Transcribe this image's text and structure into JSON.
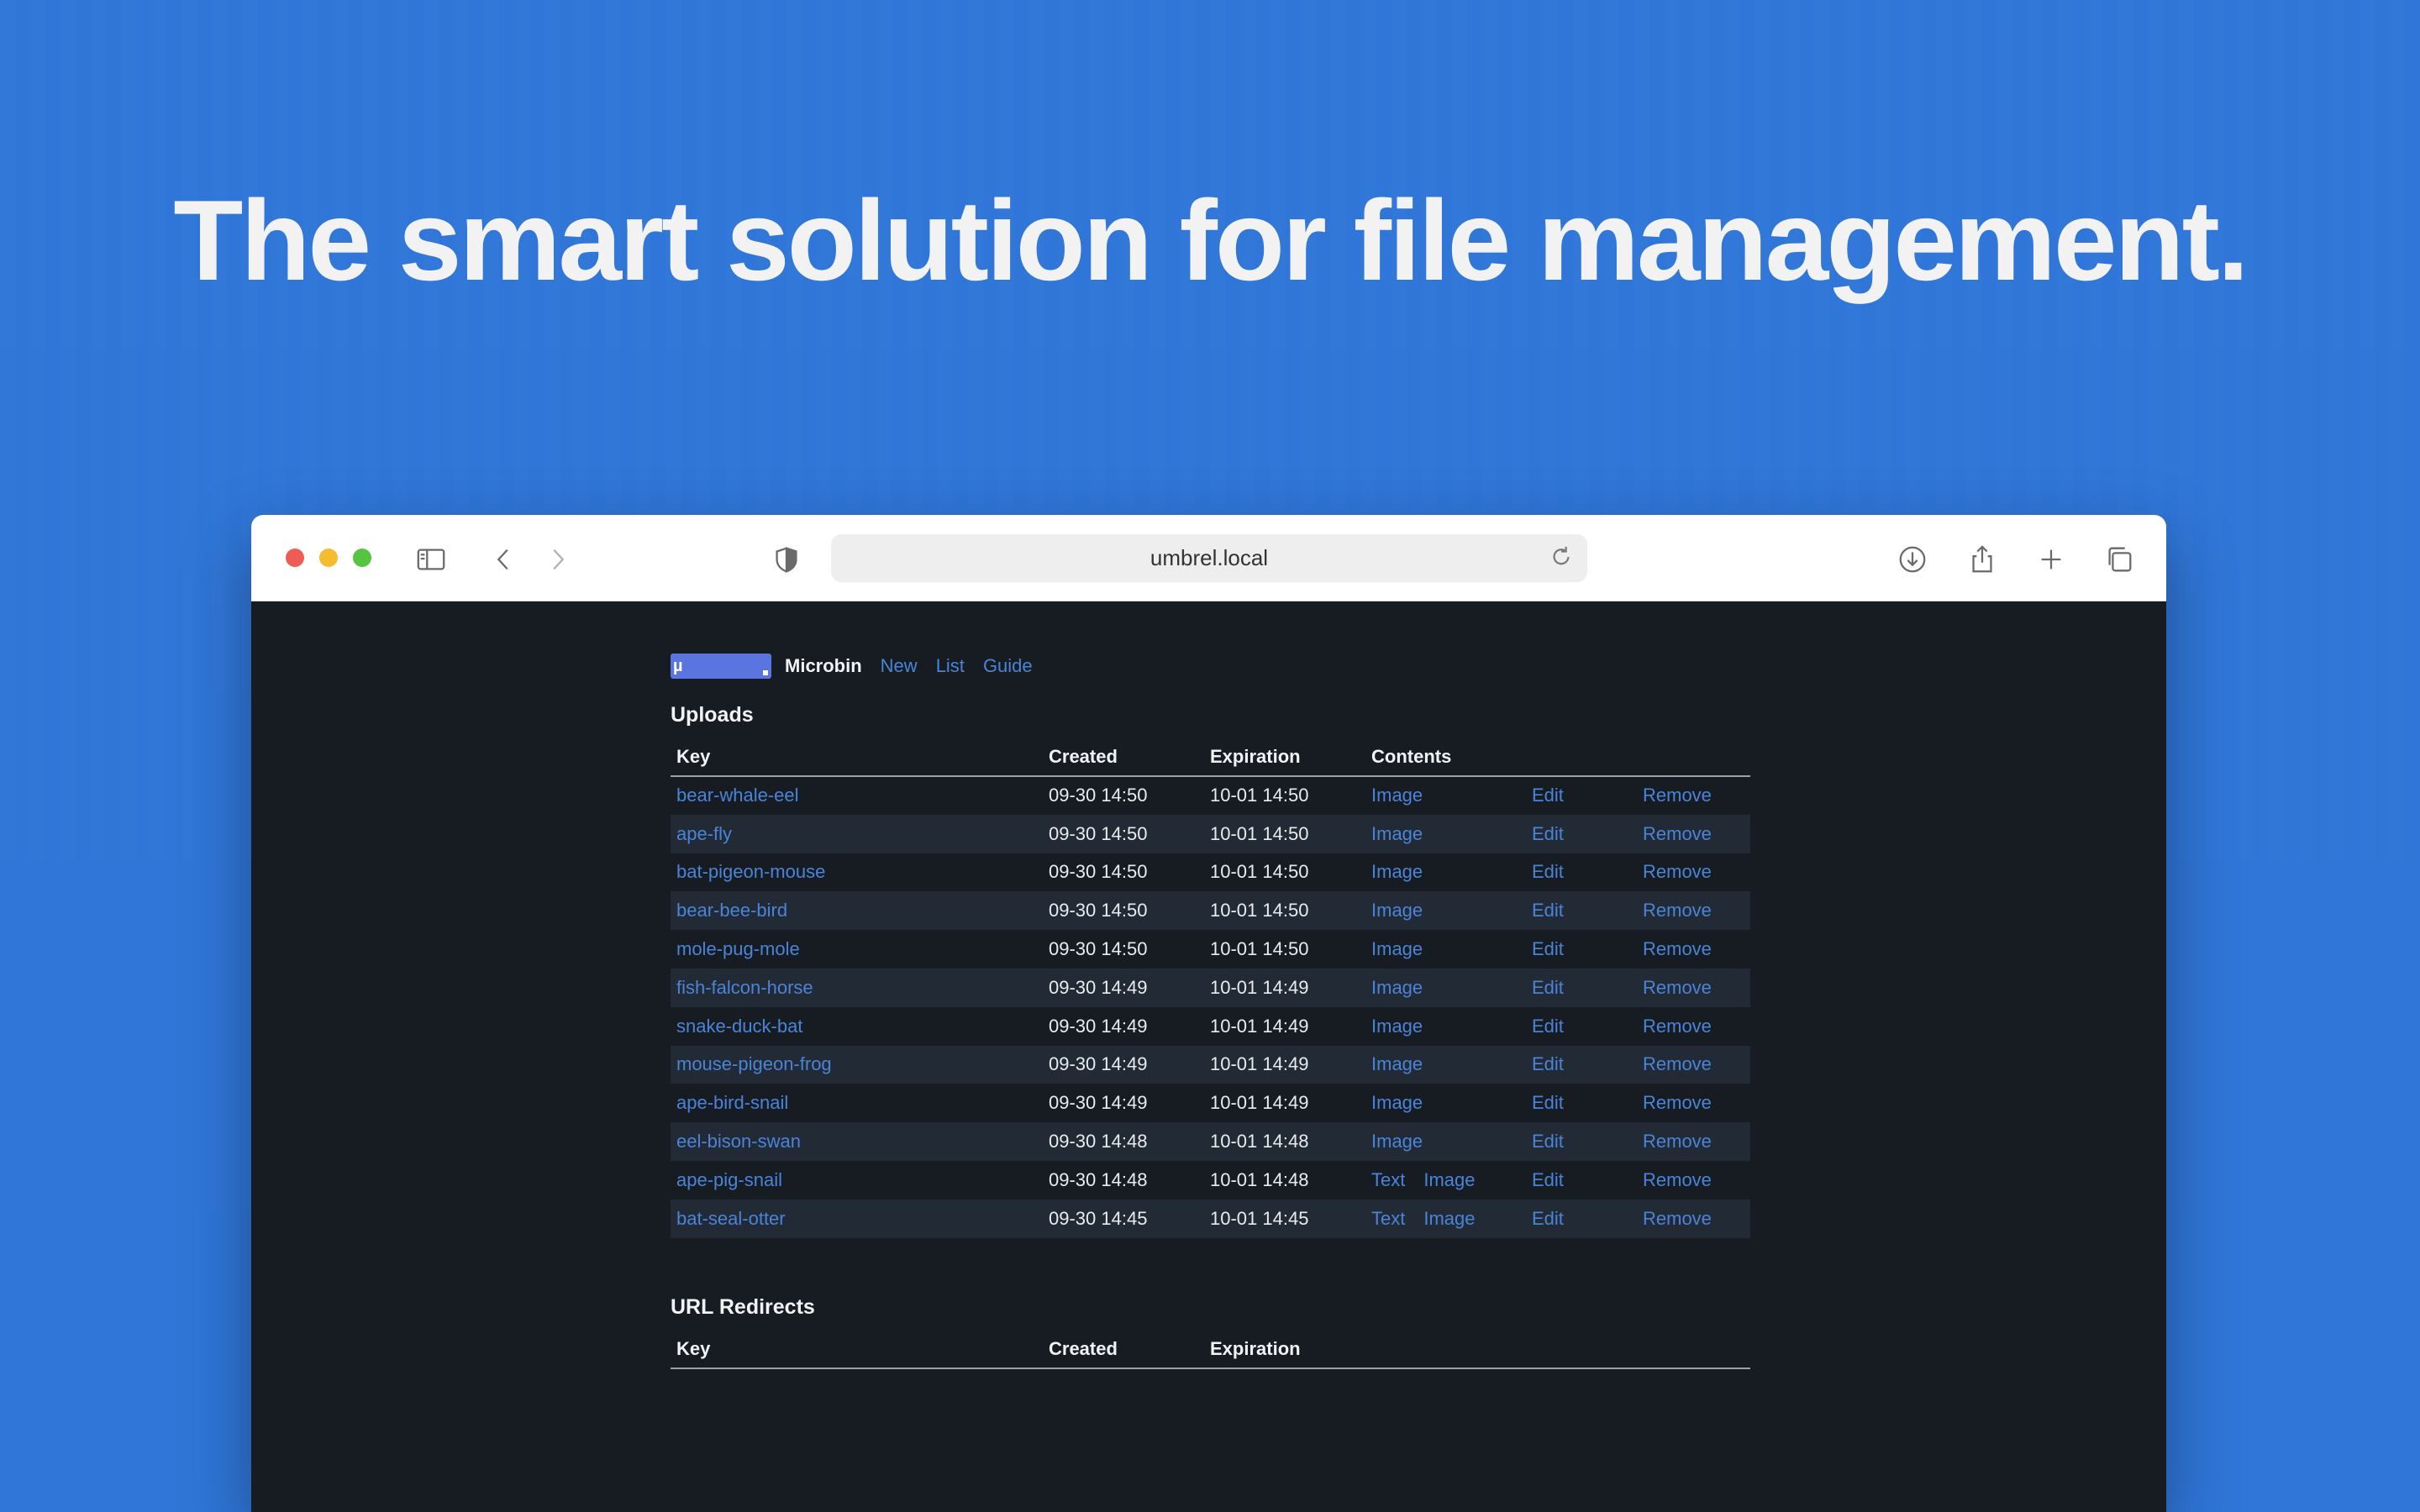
{
  "headline": "The smart solution for file management.",
  "browser": {
    "url": "umbrel.local"
  },
  "app": {
    "brand": "Microbin",
    "logo_text": "µ",
    "nav": [
      "New",
      "List",
      "Guide"
    ]
  },
  "uploads": {
    "title": "Uploads",
    "headers": {
      "key": "Key",
      "created": "Created",
      "expiration": "Expiration",
      "contents": "Contents"
    },
    "rows": [
      {
        "key": "bear-whale-eel",
        "created": "09-30 14:50",
        "expiration": "10-01 14:50",
        "text": "",
        "image": "Image",
        "edit": "Edit",
        "remove": "Remove"
      },
      {
        "key": "ape-fly",
        "created": "09-30 14:50",
        "expiration": "10-01 14:50",
        "text": "",
        "image": "Image",
        "edit": "Edit",
        "remove": "Remove"
      },
      {
        "key": "bat-pigeon-mouse",
        "created": "09-30 14:50",
        "expiration": "10-01 14:50",
        "text": "",
        "image": "Image",
        "edit": "Edit",
        "remove": "Remove"
      },
      {
        "key": "bear-bee-bird",
        "created": "09-30 14:50",
        "expiration": "10-01 14:50",
        "text": "",
        "image": "Image",
        "edit": "Edit",
        "remove": "Remove"
      },
      {
        "key": "mole-pug-mole",
        "created": "09-30 14:50",
        "expiration": "10-01 14:50",
        "text": "",
        "image": "Image",
        "edit": "Edit",
        "remove": "Remove"
      },
      {
        "key": "fish-falcon-horse",
        "created": "09-30 14:49",
        "expiration": "10-01 14:49",
        "text": "",
        "image": "Image",
        "edit": "Edit",
        "remove": "Remove"
      },
      {
        "key": "snake-duck-bat",
        "created": "09-30 14:49",
        "expiration": "10-01 14:49",
        "text": "",
        "image": "Image",
        "edit": "Edit",
        "remove": "Remove"
      },
      {
        "key": "mouse-pigeon-frog",
        "created": "09-30 14:49",
        "expiration": "10-01 14:49",
        "text": "",
        "image": "Image",
        "edit": "Edit",
        "remove": "Remove"
      },
      {
        "key": "ape-bird-snail",
        "created": "09-30 14:49",
        "expiration": "10-01 14:49",
        "text": "",
        "image": "Image",
        "edit": "Edit",
        "remove": "Remove"
      },
      {
        "key": "eel-bison-swan",
        "created": "09-30 14:48",
        "expiration": "10-01 14:48",
        "text": "",
        "image": "Image",
        "edit": "Edit",
        "remove": "Remove"
      },
      {
        "key": "ape-pig-snail",
        "created": "09-30 14:48",
        "expiration": "10-01 14:48",
        "text": "Text",
        "image": "Image",
        "edit": "Edit",
        "remove": "Remove"
      },
      {
        "key": "bat-seal-otter",
        "created": "09-30 14:45",
        "expiration": "10-01 14:45",
        "text": "Text",
        "image": "Image",
        "edit": "Edit",
        "remove": "Remove"
      }
    ]
  },
  "redirects": {
    "title": "URL Redirects",
    "headers": {
      "key": "Key",
      "created": "Created",
      "expiration": "Expiration"
    }
  },
  "colors": {
    "background": "#2f76d8",
    "page": "#171c23",
    "link": "#4a84d8",
    "stripe": "#222a35",
    "logo": "#5a74e0"
  },
  "icons": [
    "sidebar-icon",
    "back-icon",
    "forward-icon",
    "shield-icon",
    "reload-icon",
    "download-icon",
    "share-icon",
    "plus-icon",
    "tabs-icon"
  ]
}
